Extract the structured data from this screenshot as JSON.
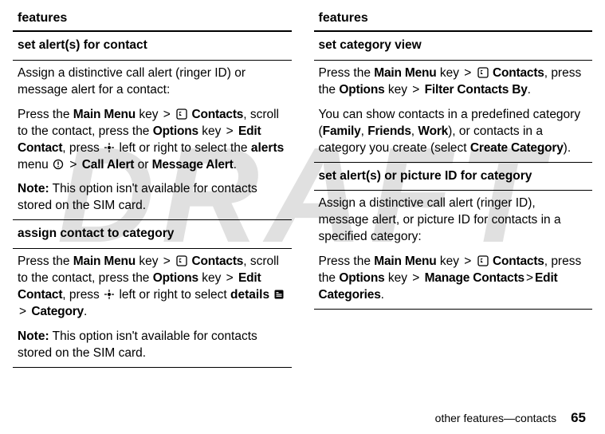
{
  "watermark": "DRAFT",
  "left": {
    "header": "features",
    "sec1": {
      "title": "set alert(s) for contact",
      "p1a": "Assign a distinctive call alert (ringer ID) or message alert for a contact:",
      "p2_press": "Press the ",
      "p2_mainmenu": "Main Menu",
      "p2_key": " key ",
      "p2_gt1": ">",
      "p2_contacts": "Contacts",
      "p2_scroll": ", scroll to the contact, press the ",
      "p2_options": "Options",
      "p2_key2": " key ",
      "p2_gt2": ">",
      "p2_editcontact": "Edit Contact",
      "p2_press2": ", press ",
      "p2_lr": " left or right to select the ",
      "p2_alerts": "alerts",
      "p2_menu": " menu ",
      "p2_gt3": ">",
      "p2_callalert": "Call Alert",
      "p2_or": " or ",
      "p2_msgalert": "Message Alert",
      "p2_end": ".",
      "note_label": "Note:",
      "note_body": " This option isn't available for contacts stored on the SIM card."
    },
    "sec2": {
      "title": "assign contact to category",
      "p2_press": "Press the ",
      "p2_mainmenu": "Main Menu",
      "p2_key": " key ",
      "p2_gt1": ">",
      "p2_contacts": "Contacts",
      "p2_scroll": ", scroll to the contact, press the ",
      "p2_options": "Options",
      "p2_key2": " key ",
      "p2_gt2": ">",
      "p2_editcontact": "Edit Contact",
      "p2_press2": ", press ",
      "p2_lr": " left or right to select ",
      "p2_details": "details",
      "p2_gt3": ">",
      "p2_category": "Category",
      "p2_end": ".",
      "note_label": "Note:",
      "note_body": " This option isn't available for contacts stored on the SIM card."
    }
  },
  "right": {
    "header": "features",
    "sec1": {
      "title": "set category view",
      "p1_press": "Press the ",
      "p1_mainmenu": "Main Menu",
      "p1_key": " key ",
      "p1_gt1": ">",
      "p1_contacts": "Contacts",
      "p1_pressthe": ", press the ",
      "p1_options": "Options",
      "p1_key2": " key ",
      "p1_gt2": ">",
      "p1_filter": "Filter Contacts By",
      "p1_end": ".",
      "p2a": "You can show contacts in a predefined category (",
      "p2_family": "Family",
      "p2_c1": ", ",
      "p2_friends": "Friends",
      "p2_c2": ", ",
      "p2_work": "Work",
      "p2b": "), or contacts in a category you create (select ",
      "p2_create": "Create Category",
      "p2c": ")."
    },
    "sec2": {
      "title": "set alert(s) or picture ID for category",
      "p1": "Assign a distinctive call alert (ringer ID), message alert, or picture ID for contacts in a specified category:",
      "p2_press": "Press the ",
      "p2_mainmenu": "Main Menu",
      "p2_key": " key ",
      "p2_gt1": ">",
      "p2_contacts": "Contacts",
      "p2_pressthe": ", press the ",
      "p2_options": "Options",
      "p2_key2": " key ",
      "p2_gt2": ">",
      "p2_manage": "Manage Contacts",
      "p2_gt3": ">",
      "p2_editcat": "Edit Categories",
      "p2_end": "."
    }
  },
  "footer": {
    "text": "other features—contacts",
    "page": "65"
  },
  "icons": {
    "contacts": "contacts-icon",
    "nav": "nav-dot-icon",
    "alert": "alert-circle-icon",
    "details": "details-square-icon"
  }
}
